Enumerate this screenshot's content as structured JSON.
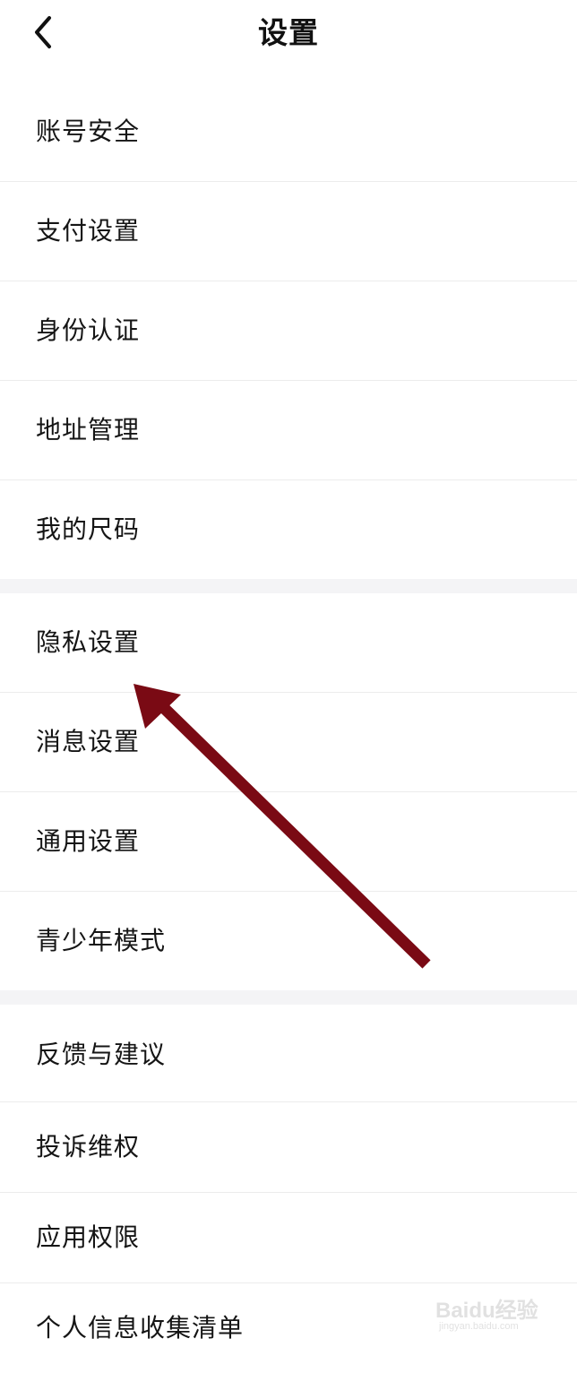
{
  "header": {
    "title": "设置",
    "back_icon": "chevron-left-icon"
  },
  "section1": {
    "items": [
      {
        "label": "账号安全"
      },
      {
        "label": "支付设置"
      },
      {
        "label": "身份认证"
      },
      {
        "label": "地址管理"
      },
      {
        "label": "我的尺码"
      }
    ]
  },
  "section2": {
    "items": [
      {
        "label": "隐私设置"
      },
      {
        "label": "消息设置"
      },
      {
        "label": "通用设置"
      },
      {
        "label": "青少年模式"
      }
    ]
  },
  "section3": {
    "items": [
      {
        "label": "反馈与建议"
      },
      {
        "label": "投诉维权"
      },
      {
        "label": "应用权限"
      },
      {
        "label": "个人信息收集清单"
      }
    ]
  },
  "annotation": {
    "arrow_color": "#7a0a14",
    "points_to": "隐私设置"
  },
  "watermark": {
    "brand": "Baidu经验",
    "url": "jingyan.baidu.com"
  },
  "colors": {
    "background": "#ffffff",
    "divider": "#ececec",
    "section_gap": "#f4f4f6",
    "text": "#151515"
  }
}
